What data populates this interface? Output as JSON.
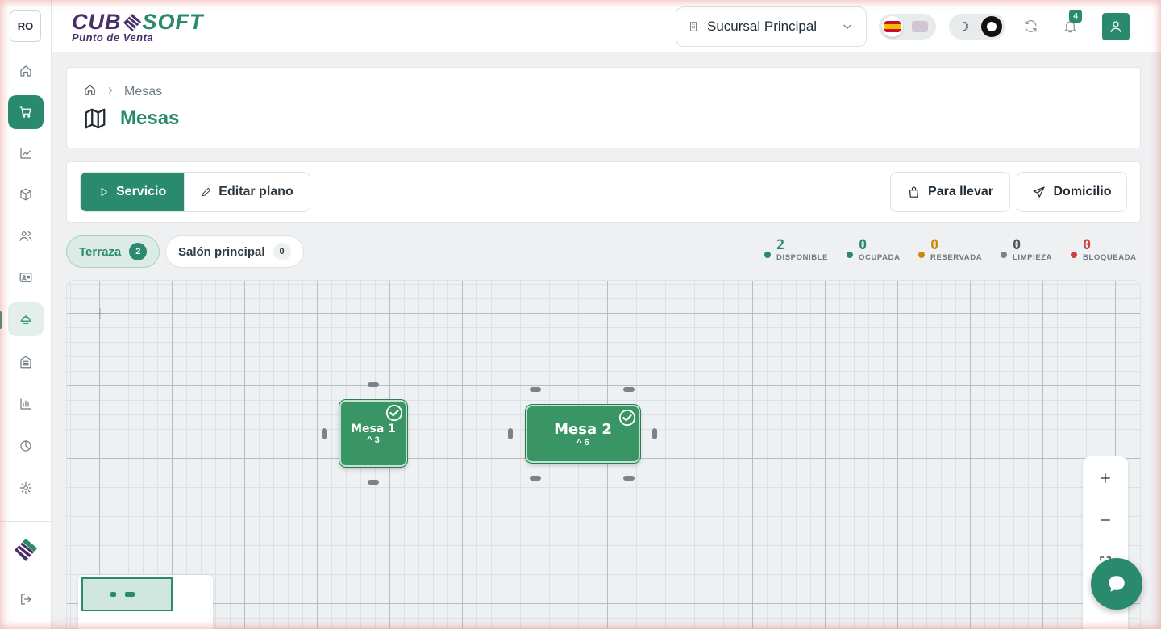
{
  "sidebar": {
    "user_initials": "RO",
    "items": [
      {
        "name": "home-icon"
      },
      {
        "name": "cart-icon",
        "state": "active"
      },
      {
        "name": "chart-line-icon"
      },
      {
        "name": "box-icon"
      },
      {
        "name": "users-icon"
      },
      {
        "name": "id-card-icon"
      },
      {
        "name": "dish-icon",
        "state": "current"
      },
      {
        "name": "building-icon"
      },
      {
        "name": "bar-chart-icon"
      },
      {
        "name": "pie-chart-icon"
      },
      {
        "name": "gear-icon"
      }
    ],
    "bottom": [
      {
        "name": "logo-mark-icon"
      },
      {
        "name": "logout-icon"
      }
    ]
  },
  "header": {
    "brand_left": "CUB",
    "brand_right": "SOFT",
    "brand_subtitle": "Punto de Venta",
    "branch": "Sucursal Principal",
    "notifications_count": "4"
  },
  "title_card": {
    "breadcrumb_current": "Mesas",
    "page_title": "Mesas"
  },
  "toolbar": {
    "service_label": "Servicio",
    "edit_label": "Editar plano",
    "takeaway_label": "Para llevar",
    "delivery_label": "Domicilio"
  },
  "zones": [
    {
      "label": "Terraza",
      "count": "2"
    },
    {
      "label": "Salón principal",
      "count": "0"
    }
  ],
  "status_legend": [
    {
      "count": "2",
      "label": "DISPONIBLE",
      "color": "#2a8a6e"
    },
    {
      "count": "0",
      "label": "OCUPADA",
      "color": "#2a8a6e"
    },
    {
      "count": "0",
      "label": "RESERVADA",
      "color": "#c98a12"
    },
    {
      "count": "0",
      "label": "LIMPIEZA",
      "color": "#7b8388"
    },
    {
      "count": "0",
      "label": "BLOQUEADA",
      "color": "#d04040"
    }
  ],
  "tables": [
    {
      "name": "Mesa 1",
      "capacity": "^ 3",
      "status": "disponible"
    },
    {
      "name": "Mesa 2",
      "capacity": "^ 6",
      "status": "disponible"
    }
  ],
  "colors": {
    "accent": "#2a8a6e",
    "brand_purple": "#4b2f6b",
    "table_green": "#3a9564"
  }
}
